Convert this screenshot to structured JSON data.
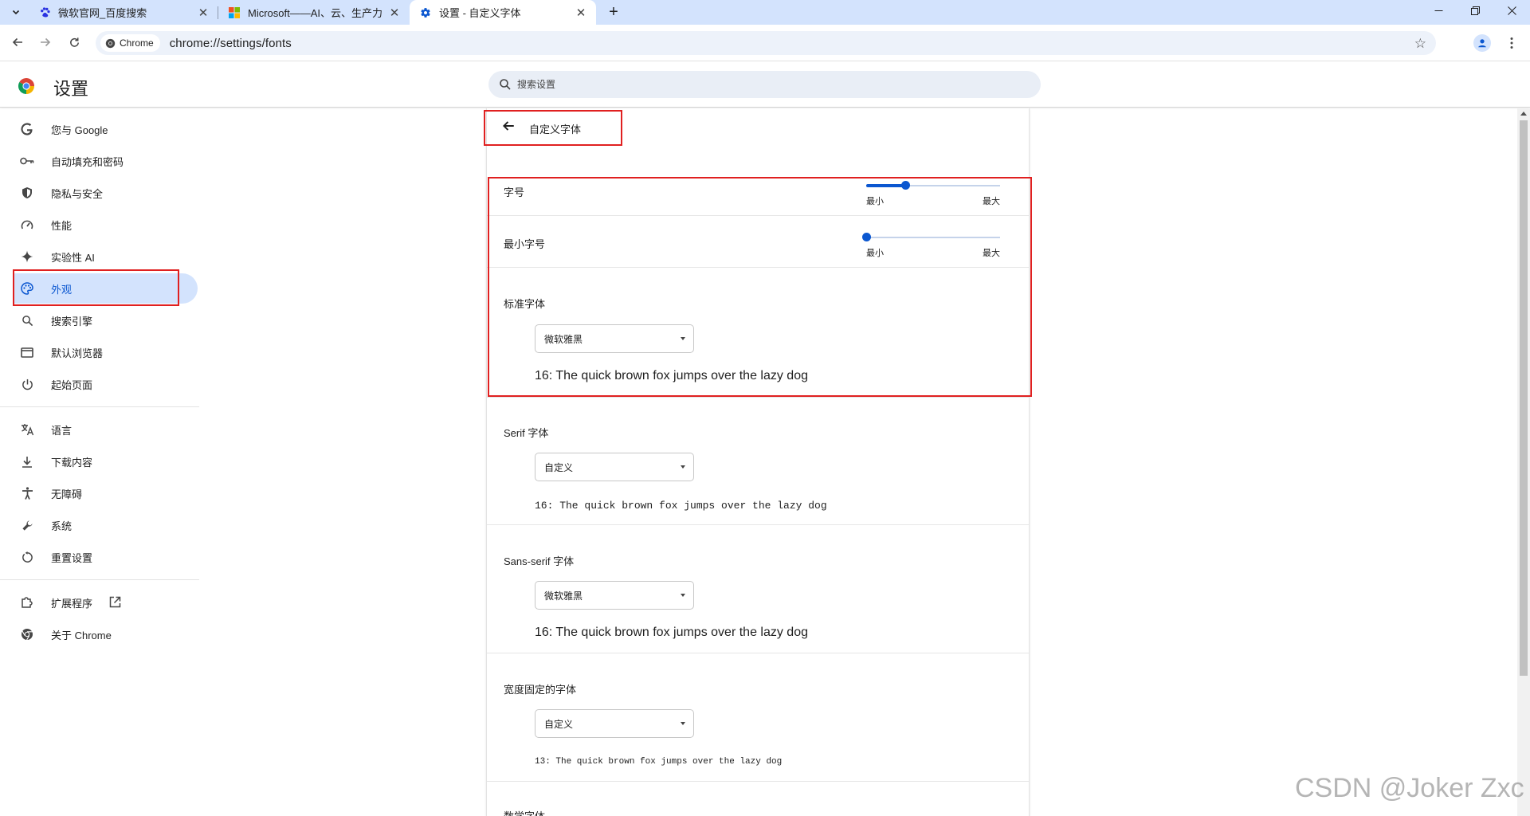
{
  "tabs": [
    {
      "title": "微软官网_百度搜索",
      "favicon": "baidu-paw-icon"
    },
    {
      "title": "Microsoft——AI、云、生产力",
      "favicon": "microsoft-logo-icon"
    },
    {
      "title": "设置 - 自定义字体",
      "favicon": "settings-gear-icon",
      "active": true
    }
  ],
  "toolbar": {
    "chip_label": "Chrome",
    "url": "chrome://settings/fonts"
  },
  "settings": {
    "title": "设置",
    "search_placeholder": "搜索设置"
  },
  "sidebar": {
    "items": [
      {
        "label": "您与 Google",
        "icon": "google-g-icon"
      },
      {
        "label": "自动填充和密码",
        "icon": "key-icon"
      },
      {
        "label": "隐私与安全",
        "icon": "shield-icon"
      },
      {
        "label": "性能",
        "icon": "speedometer-icon"
      },
      {
        "label": "实验性 AI",
        "icon": "sparkle-icon"
      },
      {
        "label": "外观",
        "icon": "palette-icon",
        "selected": true
      },
      {
        "label": "搜索引擎",
        "icon": "search-icon"
      },
      {
        "label": "默认浏览器",
        "icon": "browser-window-icon"
      },
      {
        "label": "起始页面",
        "icon": "power-icon"
      },
      {
        "label": "语言",
        "icon": "translate-icon"
      },
      {
        "label": "下载内容",
        "icon": "download-icon"
      },
      {
        "label": "无障碍",
        "icon": "accessibility-icon"
      },
      {
        "label": "系统",
        "icon": "wrench-icon"
      },
      {
        "label": "重置设置",
        "icon": "reset-icon"
      },
      {
        "label": "扩展程序",
        "icon": "extension-puzzle-icon"
      },
      {
        "label": "关于 Chrome",
        "icon": "chrome-logo-icon"
      }
    ]
  },
  "fonts_page": {
    "title": "自定义字体",
    "font_size": {
      "label": "字号",
      "min_label": "最小",
      "max_label": "最大",
      "level": 0.29
    },
    "min_font_size": {
      "label": "最小字号",
      "min_label": "最小",
      "max_label": "最大",
      "level": 0.0
    },
    "standard": {
      "label": "标准字体",
      "value": "微软雅黑",
      "sample": "16: The quick brown fox jumps over the lazy dog"
    },
    "serif": {
      "label": "Serif 字体",
      "value": "自定义",
      "sample": "16: The quick brown fox jumps over the lazy dog"
    },
    "sans_serif": {
      "label": "Sans-serif 字体",
      "value": "微软雅黑",
      "sample": "16: The quick brown fox jumps over the lazy dog"
    },
    "fixed": {
      "label": "宽度固定的字体",
      "value": "自定义",
      "sample": "13: The quick brown fox jumps over the lazy dog"
    },
    "math": {
      "label": "数学字体"
    }
  },
  "watermark": "CSDN @Joker Zxc",
  "colors": {
    "accent": "#0b57d0",
    "selection_bg": "#d3e3fd",
    "annotation_red": "#e02020"
  }
}
